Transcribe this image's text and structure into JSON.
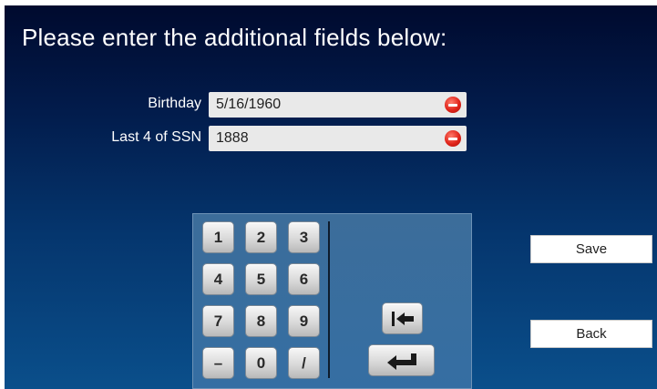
{
  "title": "Please enter the additional fields below:",
  "fields": [
    {
      "label": "Birthday",
      "value": "5/16/1960"
    },
    {
      "label": "Last 4 of SSN",
      "value": "1888"
    }
  ],
  "keypad": {
    "keys": [
      "1",
      "2",
      "3",
      "4",
      "5",
      "6",
      "7",
      "8",
      "9",
      "–",
      "0",
      "/"
    ],
    "tab_icon": "tab-back-icon",
    "enter_icon": "enter-icon"
  },
  "buttons": {
    "save": "Save",
    "back": "Back"
  },
  "colors": {
    "background_top": "#000a2e",
    "background_bottom": "#0a4f8b",
    "clear_icon": "#e0241a"
  }
}
